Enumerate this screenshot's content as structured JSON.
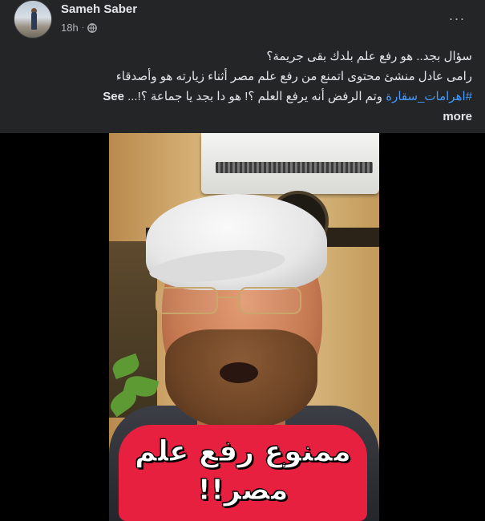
{
  "post": {
    "author_name": "Sameh Saber",
    "timestamp": "18h",
    "separator": "·",
    "privacy_icon": "globe-icon",
    "more_icon": "···"
  },
  "content": {
    "line1": "سؤال بجد.. هو رفع علم بلدك بقى جريمة؟",
    "line2": "رامى عادل منشئ محتوى اتمنع من رفع علم مصر أثناء زيارته هو وأصدقاء",
    "hashtag": "#اهرامات_سقارة",
    "line3_rest": " وتم الرفض أنه يرفع العلم ؟! هو دا بجد يا جماعة ؟!... ",
    "see_more_part1": "See",
    "see_more_part2": "more"
  },
  "video": {
    "caption_line1": "ممنوع رفع علم",
    "caption_line2": "مصر!!",
    "caption_color": "#e8203f"
  }
}
